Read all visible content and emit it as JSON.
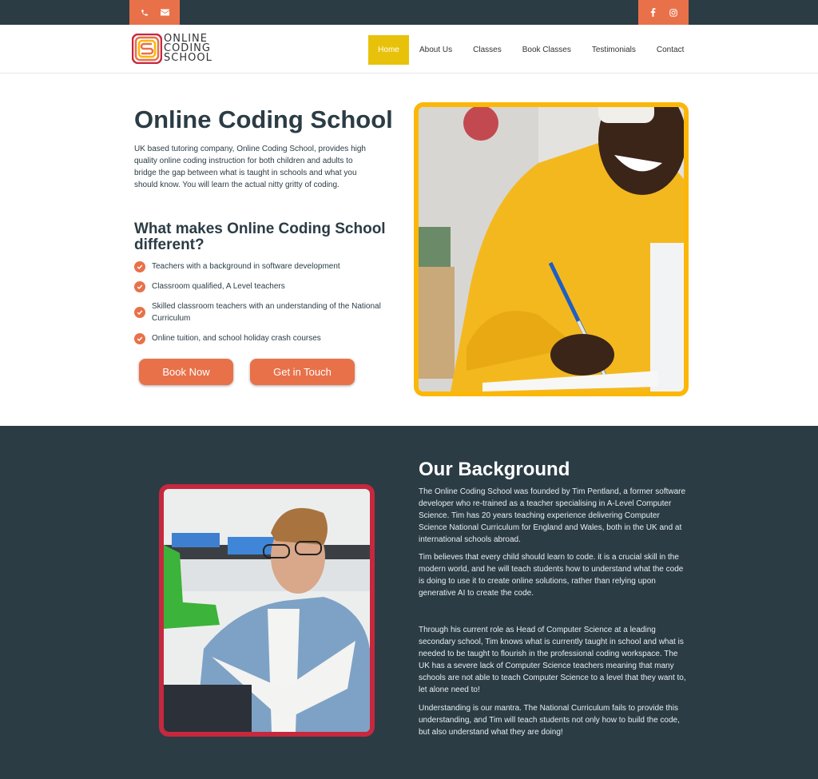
{
  "topbar": {
    "left_icons": [
      "phone-icon",
      "email-icon"
    ],
    "right_icons": [
      "facebook-icon",
      "instagram-icon"
    ],
    "accent": "#e8714a",
    "bg": "#2b3c45"
  },
  "brand": {
    "logo_letter": "S",
    "lines": [
      "ONLINE",
      "CODING",
      "SCHOOL"
    ]
  },
  "nav": {
    "items": [
      {
        "label": "Home",
        "active": true
      },
      {
        "label": "About Us",
        "active": false
      },
      {
        "label": "Classes",
        "active": false
      },
      {
        "label": "Book Classes",
        "active": false
      },
      {
        "label": "Testimonials",
        "active": false
      },
      {
        "label": "Contact",
        "active": false
      }
    ],
    "active_color": "#e8c20a"
  },
  "hero": {
    "title": "Online Coding School",
    "intro": "UK based tutoring company, Online Coding School, provides high quality online coding instruction for both children and adults to bridge the gap between what is taught in schools and what you should know. You will learn the actual nitty gritty of coding.",
    "subtitle": "What makes Online Coding School different?",
    "features": [
      "Teachers with a background in software development",
      "Classroom qualified, A Level teachers",
      "Skilled classroom teachers with an understanding of the National Curriculum",
      "Online tuition, and school holiday crash courses"
    ],
    "buttons": {
      "book_now": "Book Now",
      "get_in_touch": "Get in Touch"
    },
    "image_alt": "Student in yellow sweater writing in notebook",
    "frame_color": "#fbb708"
  },
  "about": {
    "title": "Our Background",
    "paragraphs": [
      "The Online Coding School was founded by Tim Pentland, a former software developer who re-trained as a teacher specialising in A-Level Computer Science. Tim has 20 years teaching experience delivering Computer Science National Curriculum for England and Wales, both in the UK and at international schools abroad.",
      "Tim believes that every child should learn to code. it is a crucial skill in the modern world, and he will teach students how to understand what the code is doing to use it to create online solutions, rather than relying upon generative AI to create the code.",
      "Through his current role as Head of Computer Science at a leading secondary school, Tim knows what is currently taught in school and what is needed to be taught to flourish in the professional coding workspace. The UK has a severe lack of Computer Science teachers meaning that many schools are not able to teach Computer Science to a level that they want to, let alone need to!",
      "Understanding is our mantra. The National Curriculum fails to provide this understanding, and Tim will teach students not only how to build the code, but also understand what they are doing!"
    ],
    "image_alt": "Teacher with glasses reading papers",
    "frame_color": "#c6283e"
  }
}
